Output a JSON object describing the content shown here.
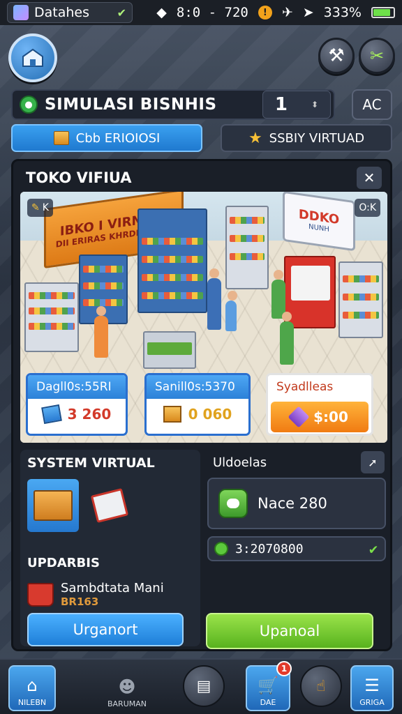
{
  "status_bar": {
    "app_name": "Datahes",
    "time": "8:0 - 720",
    "alert_badge": "!",
    "battery_label": "333%"
  },
  "header": {
    "title": "SIMULASI BISNHIS",
    "stepper_value": "1",
    "side_button": "AC"
  },
  "tabs": [
    {
      "label": "Cbb ERIOIOSI",
      "active": true
    },
    {
      "label": "SSBIY VIRTUAD",
      "active": false
    }
  ],
  "panel": {
    "title": "TOKO VIFIUA",
    "close_label": "✕"
  },
  "scene": {
    "banner_line1": "IBKO I VIRNING",
    "banner_line2": "DII ERIRAS KHRDRIRAAH",
    "sign_line1": "DDKO",
    "sign_line2": "NUNH",
    "badge_left": "K",
    "badge_right": "O:K"
  },
  "stat_cards": [
    {
      "caption": "Dagll0s:55RI",
      "value": "3 260"
    },
    {
      "caption": "Sanill0s:5370",
      "value": "0 060"
    },
    {
      "caption": "Syadlleas",
      "value": "$:00"
    }
  ],
  "system_panel": {
    "title": "SYSTEM VIRTUAL",
    "subtitle": "UPDARBIS",
    "item_name": "Sambdtata Mani",
    "item_code": "BR163",
    "button_label": "Urganort"
  },
  "updates_panel": {
    "title": "Uldoelas",
    "card_text": "Nace 280",
    "money_value": "3:2070800",
    "button_label": "Upanoal"
  },
  "bottom_nav": [
    {
      "label": "NILEBN"
    },
    {
      "label": "BARUMAN"
    },
    {
      "label": ""
    },
    {
      "label": "DAE",
      "badge": "1"
    },
    {
      "label": ""
    },
    {
      "label": "GRIGA"
    }
  ]
}
